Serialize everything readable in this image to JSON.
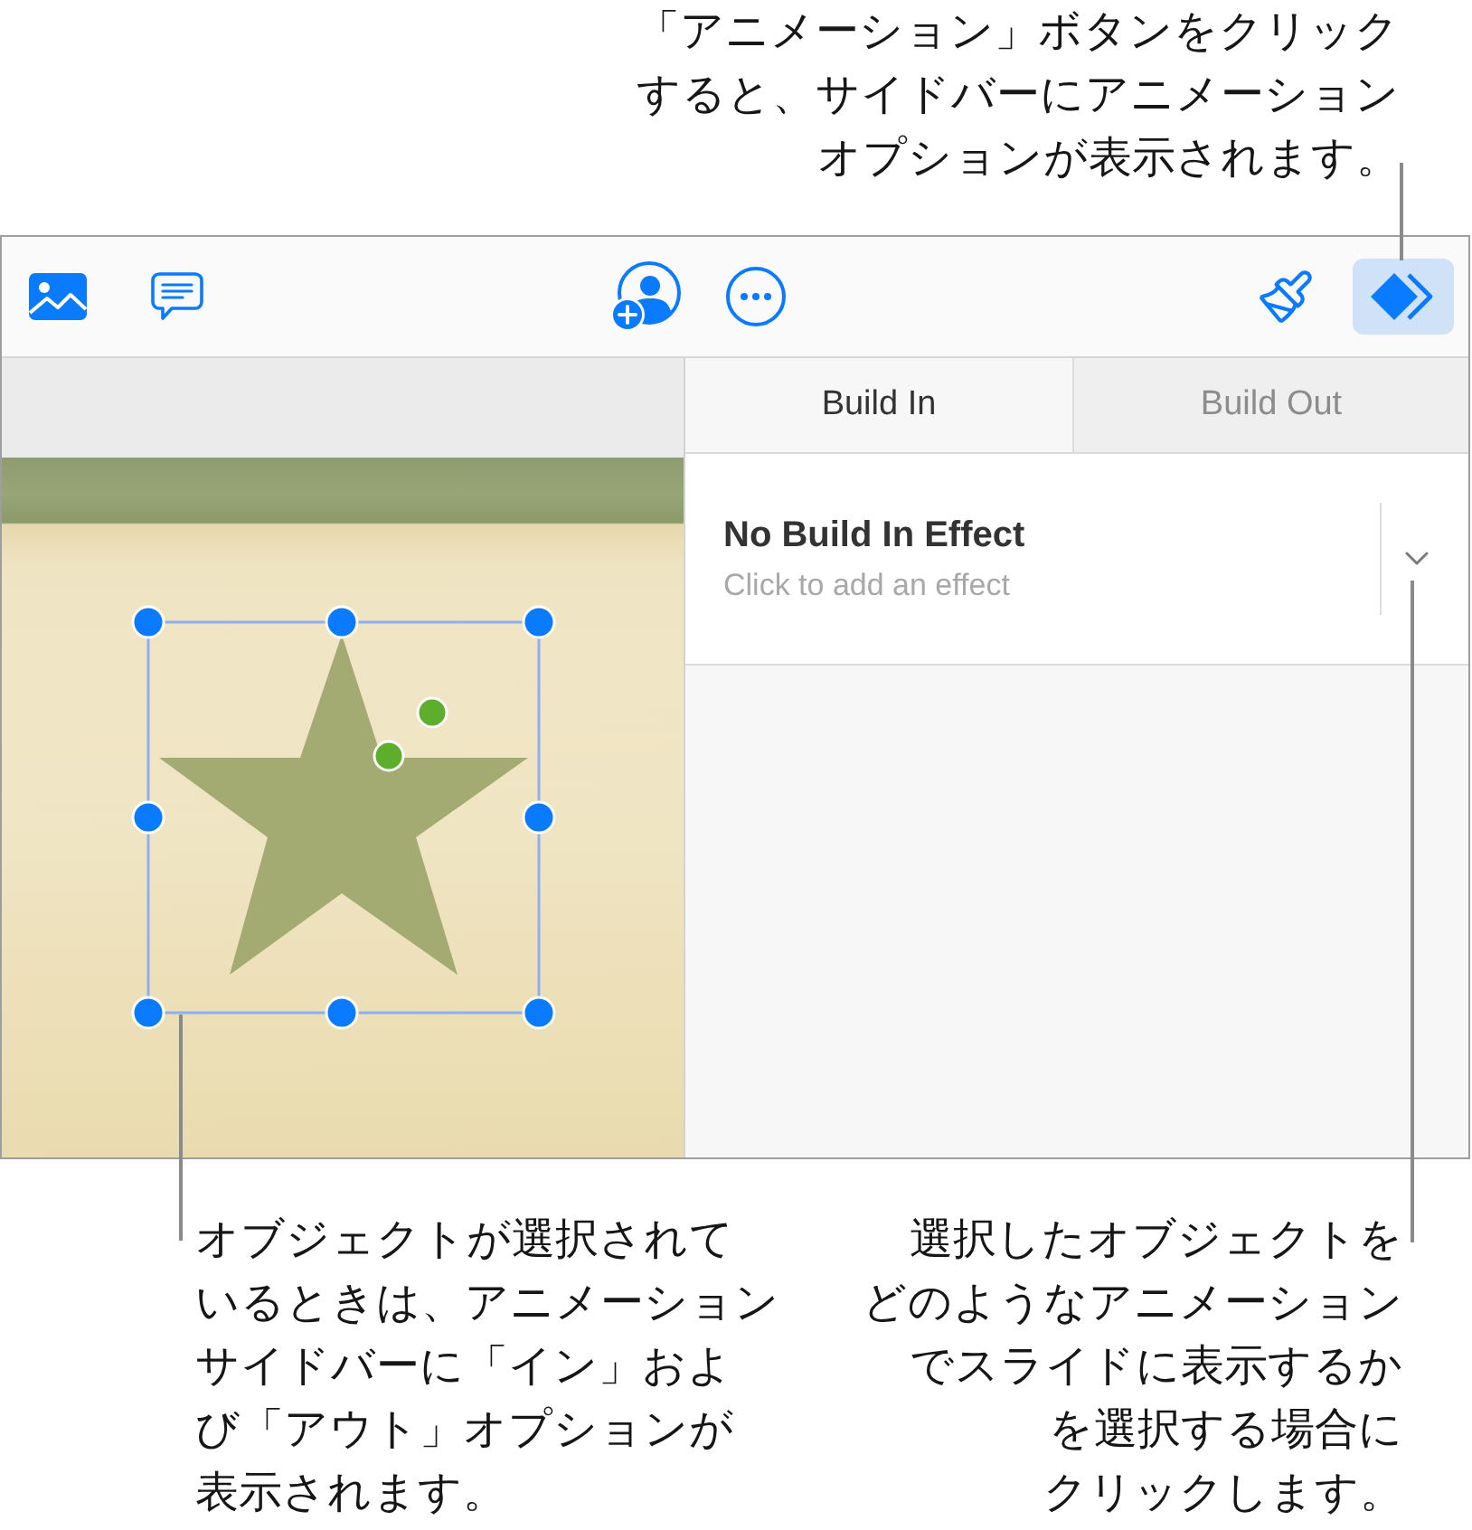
{
  "top_callout": {
    "lines": [
      "「アニメーション」ボタンをクリック",
      "すると、サイドバーにアニメーション",
      "オプションが表示されます。"
    ]
  },
  "toolbar": {
    "inspector_buttons": [
      {
        "selected": false
      },
      {
        "selected": true
      }
    ]
  },
  "slide": {
    "shape": {
      "selected": true
    }
  },
  "tabs": [
    {
      "label": "Build In",
      "selected": true
    },
    {
      "label": "Build Out",
      "selected": false
    }
  ],
  "effect": {
    "title": "No Build In Effect",
    "hint": "Click to add an effect"
  },
  "bottom_callouts": [
    {
      "lines": [
        "オブジェクトが選択されて",
        "いるときは、アニメーション",
        "サイドバーに「イン」およ",
        "び「アウト」オプションが",
        "表示されます。"
      ]
    },
    {
      "lines": [
        "選択したオブジェクトを",
        "どのようなアニメーション",
        "でスライドに表示するか",
        "を選択する場合に",
        "クリックします。"
      ]
    }
  ]
}
